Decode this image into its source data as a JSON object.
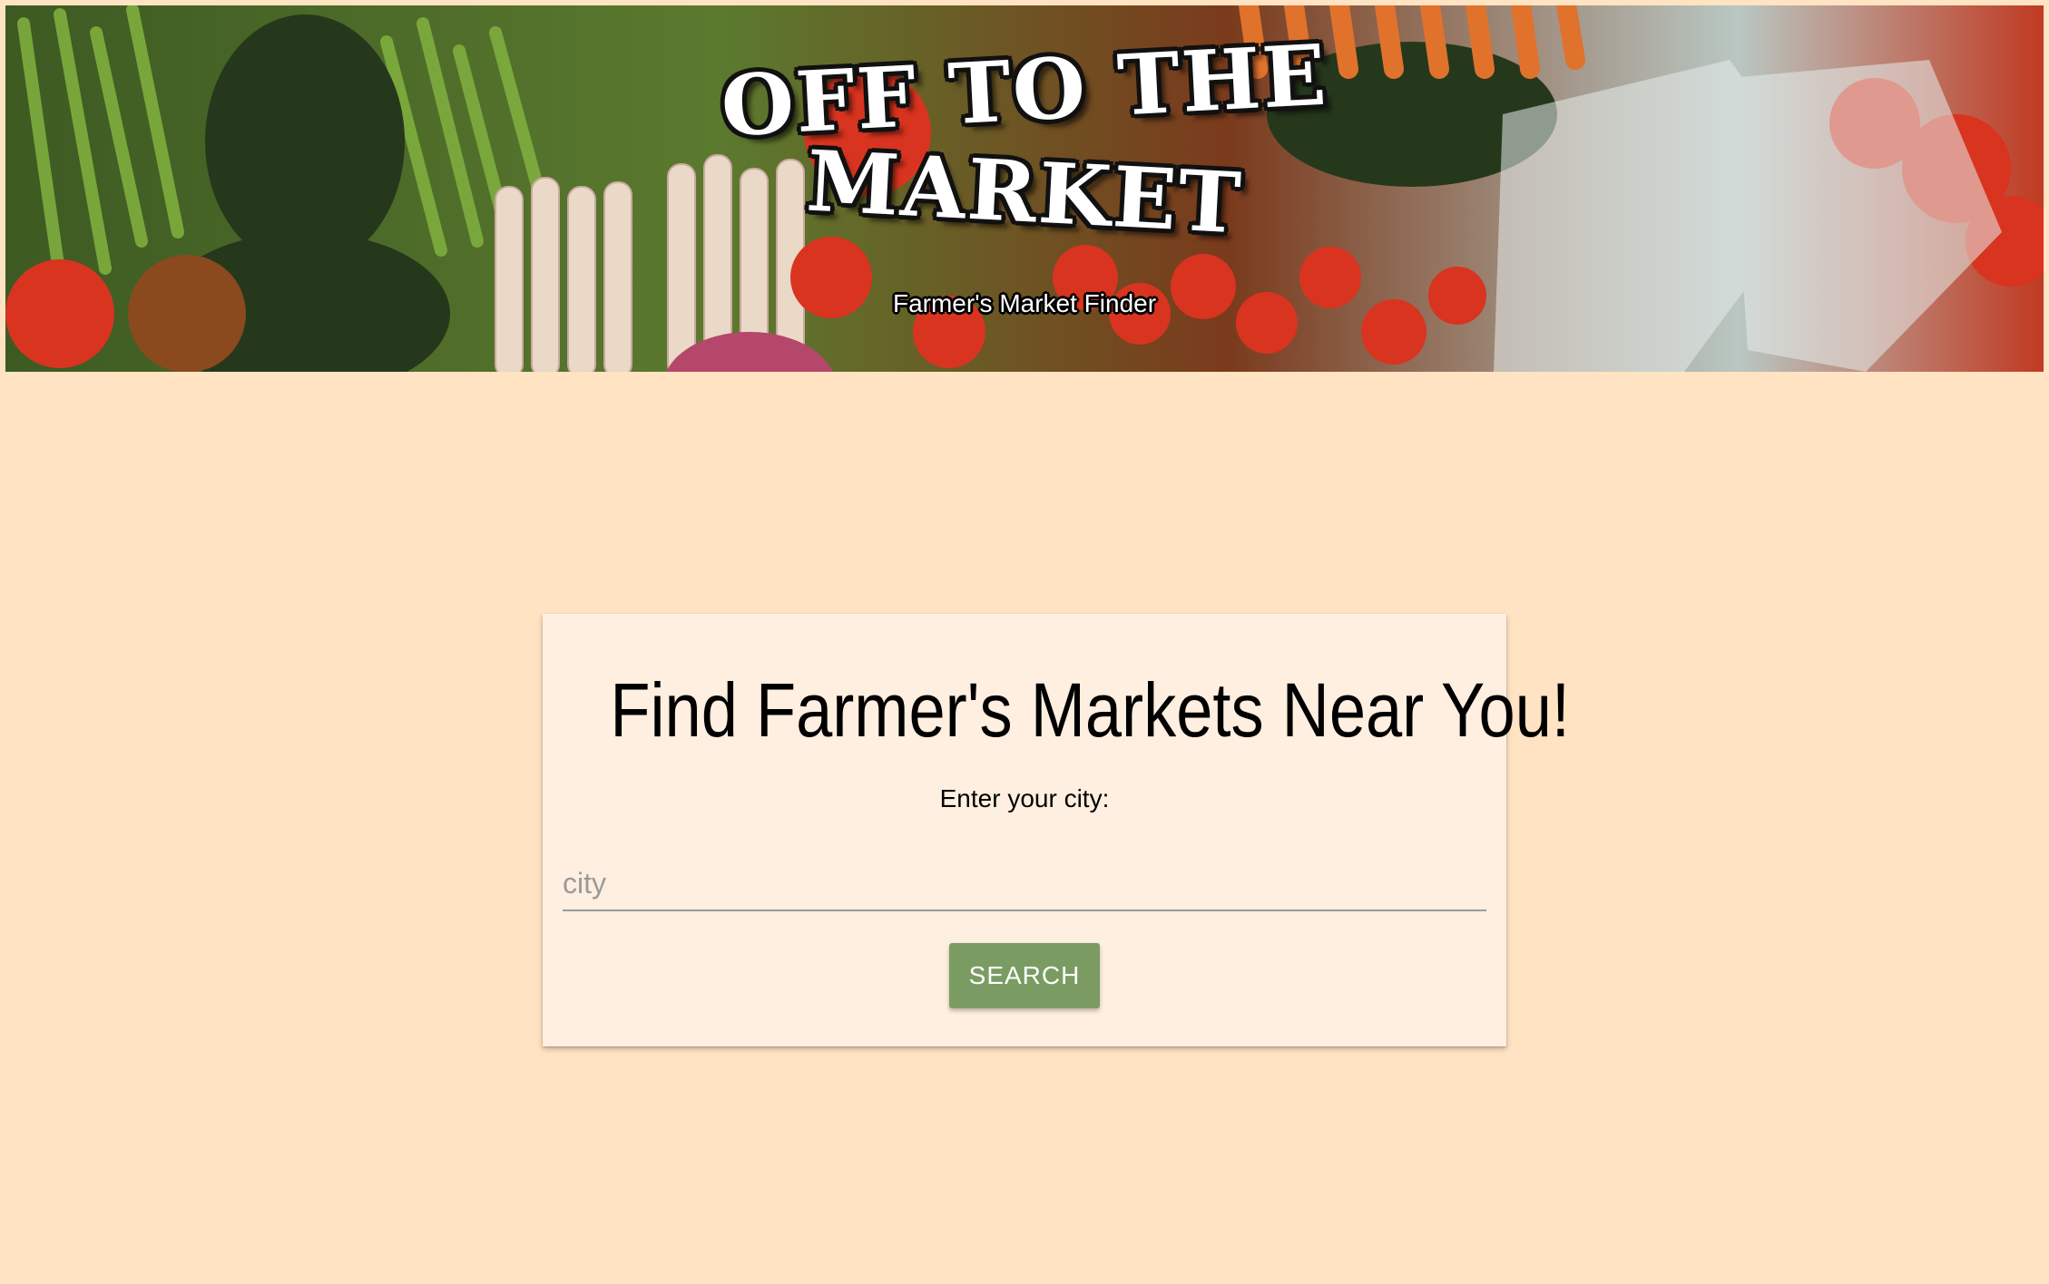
{
  "banner": {
    "title_line1": "OFF TO THE",
    "title_line2": "MARKET",
    "subtitle": "Farmer's Market Finder",
    "image_alt": "produce stand with vegetables"
  },
  "search": {
    "heading": "Find Farmer's Markets Near You!",
    "label": "Enter your city:",
    "placeholder": "city",
    "value": "",
    "button_label": "SEARCH"
  },
  "colors": {
    "page_background": "#ffe3c2",
    "card_background": "#ffefe0",
    "button_background": "#7a9c63",
    "button_text": "#ffffff"
  }
}
